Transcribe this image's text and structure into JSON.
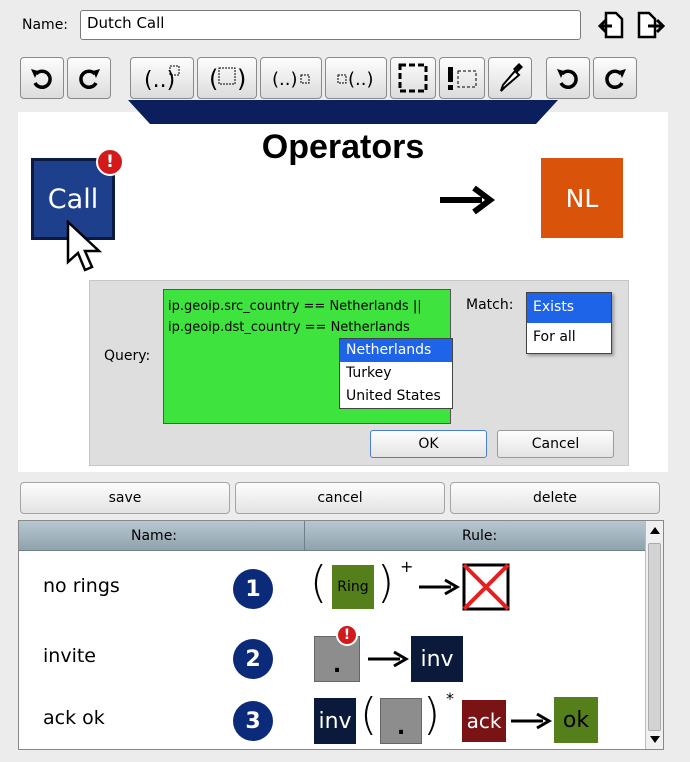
{
  "name_field": {
    "label": "Name:",
    "value": "Dutch Call"
  },
  "canvas": {
    "title": "Operators",
    "source_node": "Call",
    "target_node": "NL",
    "badge": "!"
  },
  "query_dialog": {
    "query_label": "Query:",
    "query_lines": [
      "ip.geoip.src_country == Netherlands ||",
      "ip.geoip.dst_country == Netherlands"
    ],
    "country_options": [
      "Netherlands",
      "Turkey",
      "United States"
    ],
    "match_label": "Match:",
    "match_options": [
      "Exists",
      "For all"
    ],
    "ok_label": "OK",
    "cancel_label": "Cancel"
  },
  "actions": {
    "save": "save",
    "cancel": "cancel",
    "delete": "delete"
  },
  "table": {
    "headers": {
      "name": "Name:",
      "rule": "Rule:"
    },
    "rows": [
      {
        "name": "no rings",
        "number": "1",
        "tile": "Ring",
        "sup": "+"
      },
      {
        "name": "invite",
        "number": "2",
        "tile_dot": ".",
        "target": "inv"
      },
      {
        "name": "ack ok",
        "number": "3",
        "inv": "inv",
        "dot": ".",
        "sup": "*",
        "ack": "ack",
        "ok": "ok"
      }
    ]
  },
  "toolbar": {
    "buttons": [
      "undo-icon",
      "redo-icon",
      "wrap-after-icon",
      "wrap-group-icon",
      "insert-before-icon",
      "insert-after-icon",
      "select-region-icon",
      "negate-icon",
      "eyedropper-icon",
      "undo-icon",
      "redo-icon"
    ]
  },
  "colors": {
    "green": "#3ee33e",
    "blue_node": "#1e3f8c",
    "orange_node": "#d9540a",
    "selection": "#1e64e8",
    "olive": "#557f1a",
    "navy": "#0b1a3b",
    "maroon": "#7a1414"
  }
}
